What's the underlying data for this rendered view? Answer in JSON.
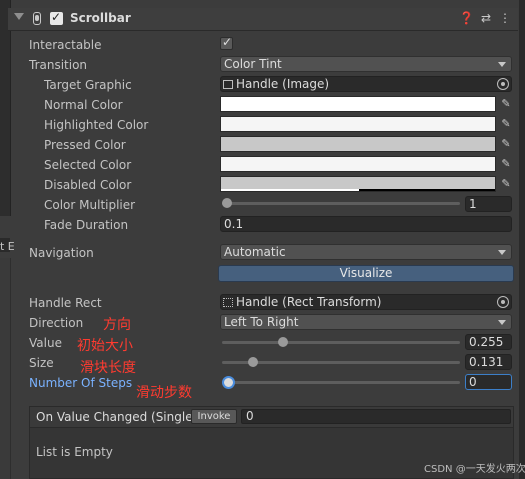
{
  "component": {
    "title": "Scrollbar",
    "enabled": true
  },
  "left_edge_text": "t E",
  "fields": {
    "interactable": {
      "label": "Interactable",
      "checked": true
    },
    "transition": {
      "label": "Transition",
      "value": "Color Tint"
    },
    "target_graphic": {
      "label": "Target Graphic",
      "value": "Handle (Image)"
    },
    "normal_color": {
      "label": "Normal Color",
      "color": "#ffffff"
    },
    "highlighted_color": {
      "label": "Highlighted Color",
      "color": "#f5f5f5"
    },
    "pressed_color": {
      "label": "Pressed Color",
      "color": "#c8c8c8"
    },
    "selected_color": {
      "label": "Selected Color",
      "color": "#f5f5f5"
    },
    "disabled_color": {
      "label": "Disabled Color",
      "color": "#c8c8c8",
      "alpha_fraction": 0.5
    },
    "color_multiplier": {
      "label": "Color Multiplier",
      "value": "1",
      "slider_fraction": 0.0
    },
    "fade_duration": {
      "label": "Fade Duration",
      "value": "0.1"
    },
    "navigation": {
      "label": "Navigation",
      "value": "Automatic"
    },
    "visualize_button": "Visualize",
    "handle_rect": {
      "label": "Handle Rect",
      "value": "Handle (Rect Transform)"
    },
    "direction": {
      "label": "Direction",
      "value": "Left To Right",
      "annotation": "方向"
    },
    "value": {
      "label": "Value",
      "value": "0.255",
      "slider_fraction": 0.255,
      "annotation": "初始大小"
    },
    "size": {
      "label": "Size",
      "value": "0.131",
      "slider_fraction": 0.131,
      "annotation": "滑块长度"
    },
    "number_of_steps": {
      "label": "Number Of Steps",
      "value": "0",
      "slider_fraction": 0.0,
      "annotation": "滑动步数"
    }
  },
  "event": {
    "title": "On Value Changed (Single)",
    "invoke_label": "Invoke",
    "invoke_value": "0",
    "empty_text": "List is Empty"
  },
  "watermark": "CSDN @一天发火两次",
  "colors": {
    "panel_bg": "#3c3c3c",
    "annotation": "#ff3b30",
    "active_label": "#7ab2ff",
    "visualize_bg": "#46607e"
  }
}
